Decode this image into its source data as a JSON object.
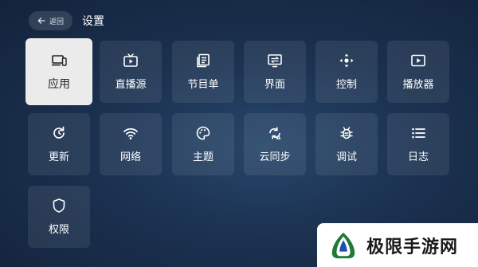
{
  "header": {
    "back_label": "返回",
    "title": "设置"
  },
  "tiles": [
    {
      "label": "应用",
      "icon": "devices-icon"
    },
    {
      "label": "直播源",
      "icon": "live-tv-icon"
    },
    {
      "label": "节目单",
      "icon": "guide-list-icon"
    },
    {
      "label": "界面",
      "icon": "interface-icon"
    },
    {
      "label": "控制",
      "icon": "control-icon"
    },
    {
      "label": "播放器",
      "icon": "player-icon"
    },
    {
      "label": "更新",
      "icon": "refresh-icon"
    },
    {
      "label": "网络",
      "icon": "wifi-icon"
    },
    {
      "label": "主题",
      "icon": "palette-icon"
    },
    {
      "label": "云同步",
      "icon": "cloud-sync-icon"
    },
    {
      "label": "调试",
      "icon": "bug-icon"
    },
    {
      "label": "日志",
      "icon": "log-list-icon"
    },
    {
      "label": "权限",
      "icon": "shield-icon"
    }
  ],
  "watermark": {
    "text": "极限手游网"
  },
  "colors": {
    "background": "#1b3150",
    "tile": "rgba(255,255,255,0.08)",
    "active_tile": "#ebebeb"
  }
}
